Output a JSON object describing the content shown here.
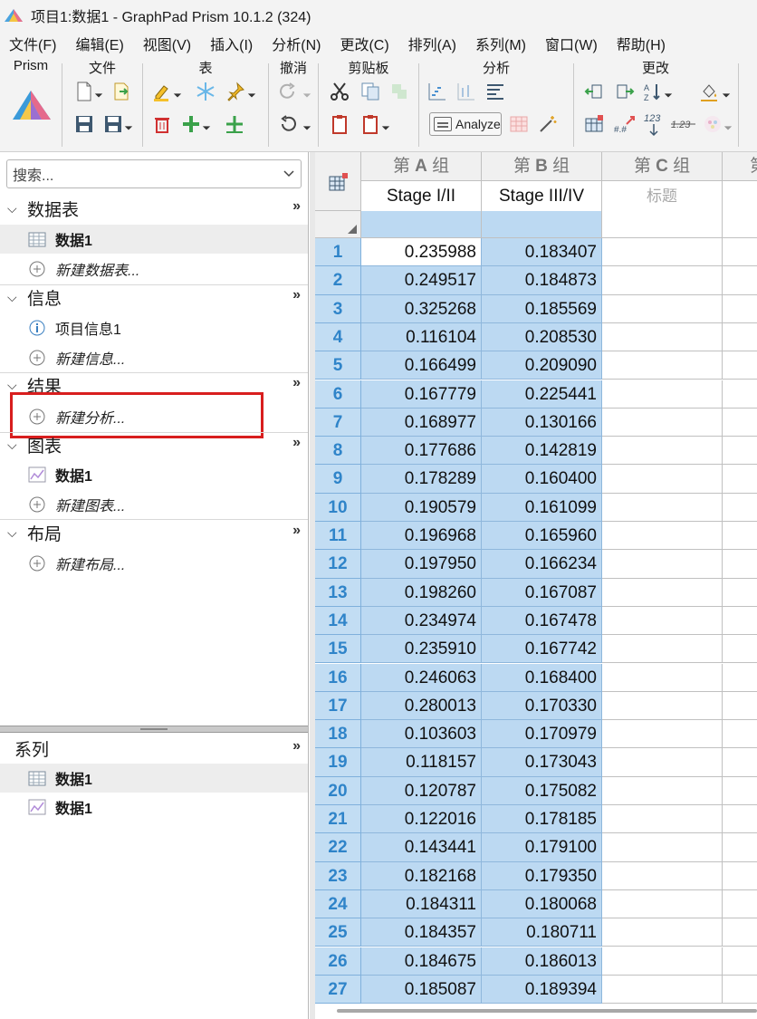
{
  "window": {
    "title": "项目1:数据1 - GraphPad Prism 10.1.2 (324)"
  },
  "menu": [
    {
      "label": "文件(F)"
    },
    {
      "label": "编辑(E)"
    },
    {
      "label": "视图(V)"
    },
    {
      "label": "插入(I)"
    },
    {
      "label": "分析(N)"
    },
    {
      "label": "更改(C)"
    },
    {
      "label": "排列(A)"
    },
    {
      "label": "系列(M)"
    },
    {
      "label": "窗口(W)"
    },
    {
      "label": "帮助(H)"
    }
  ],
  "ribbon": {
    "groups": {
      "prism": "Prism",
      "file": "文件",
      "table": "表",
      "undo": "撤消",
      "clipboard": "剪贴板",
      "analysis": "分析",
      "change": "更改"
    },
    "analyze_label": "Analyze",
    "change_123": "123",
    "change_123_decimal": "1.23",
    "change_hash": "#.#"
  },
  "navigator": {
    "search_placeholder": "搜索...",
    "sections": {
      "data_tables": {
        "title": "数据表",
        "more": "»",
        "items": [
          {
            "label": "数据1"
          }
        ],
        "new_label": "新建数据表..."
      },
      "info": {
        "title": "信息",
        "more": "»",
        "items": [
          {
            "label": "项目信息1"
          }
        ],
        "new_label": "新建信息..."
      },
      "results": {
        "title": "结果",
        "more": "»",
        "new_label": "新建分析..."
      },
      "graphs": {
        "title": "图表",
        "more": "»",
        "items": [
          {
            "label": "数据1"
          }
        ],
        "new_label": "新建图表..."
      },
      "layouts": {
        "title": "布局",
        "more": "»",
        "new_label": "新建布局..."
      }
    },
    "family": {
      "title": "系列",
      "more": "»",
      "items": [
        {
          "label": "数据1"
        },
        {
          "label": "数据1"
        }
      ]
    }
  },
  "sheet": {
    "columns": [
      {
        "group_prefix": "第",
        "group_letter": "A",
        "group_suffix": "组",
        "title": "Stage I/II"
      },
      {
        "group_prefix": "第",
        "group_letter": "B",
        "group_suffix": "组",
        "title": "Stage III/IV"
      },
      {
        "group_prefix": "第",
        "group_letter": "C",
        "group_suffix": "组",
        "title": "标题"
      },
      {
        "group_prefix": "第",
        "group_letter": "",
        "group_suffix": "",
        "title": ""
      }
    ],
    "rows": [
      {
        "n": "1",
        "a": "0.235988",
        "b": "0.183407"
      },
      {
        "n": "2",
        "a": "0.249517",
        "b": "0.184873"
      },
      {
        "n": "3",
        "a": "0.325268",
        "b": "0.185569"
      },
      {
        "n": "4",
        "a": "0.116104",
        "b": "0.208530"
      },
      {
        "n": "5",
        "a": "0.166499",
        "b": "0.209090"
      },
      {
        "n": "6",
        "a": "0.167779",
        "b": "0.225441"
      },
      {
        "n": "7",
        "a": "0.168977",
        "b": "0.130166"
      },
      {
        "n": "8",
        "a": "0.177686",
        "b": "0.142819"
      },
      {
        "n": "9",
        "a": "0.178289",
        "b": "0.160400"
      },
      {
        "n": "10",
        "a": "0.190579",
        "b": "0.161099"
      },
      {
        "n": "11",
        "a": "0.196968",
        "b": "0.165960"
      },
      {
        "n": "12",
        "a": "0.197950",
        "b": "0.166234"
      },
      {
        "n": "13",
        "a": "0.198260",
        "b": "0.167087"
      },
      {
        "n": "14",
        "a": "0.234974",
        "b": "0.167478"
      },
      {
        "n": "15",
        "a": "0.235910",
        "b": "0.167742"
      },
      {
        "n": "16",
        "a": "0.246063",
        "b": "0.168400"
      },
      {
        "n": "17",
        "a": "0.280013",
        "b": "0.170330"
      },
      {
        "n": "18",
        "a": "0.103603",
        "b": "0.170979"
      },
      {
        "n": "19",
        "a": "0.118157",
        "b": "0.173043"
      },
      {
        "n": "20",
        "a": "0.120787",
        "b": "0.175082"
      },
      {
        "n": "21",
        "a": "0.122016",
        "b": "0.178185"
      },
      {
        "n": "22",
        "a": "0.143441",
        "b": "0.179100"
      },
      {
        "n": "23",
        "a": "0.182168",
        "b": "0.179350"
      },
      {
        "n": "24",
        "a": "0.184311",
        "b": "0.180068"
      },
      {
        "n": "25",
        "a": "0.184357",
        "b": "0.180711"
      },
      {
        "n": "26",
        "a": "0.184675",
        "b": "0.186013"
      },
      {
        "n": "27",
        "a": "0.185087",
        "b": "0.189394"
      }
    ]
  },
  "colors": {
    "selection": "#bcd9f2",
    "row_number": "#2f84c9",
    "highlight_box": "#d81e1e"
  }
}
